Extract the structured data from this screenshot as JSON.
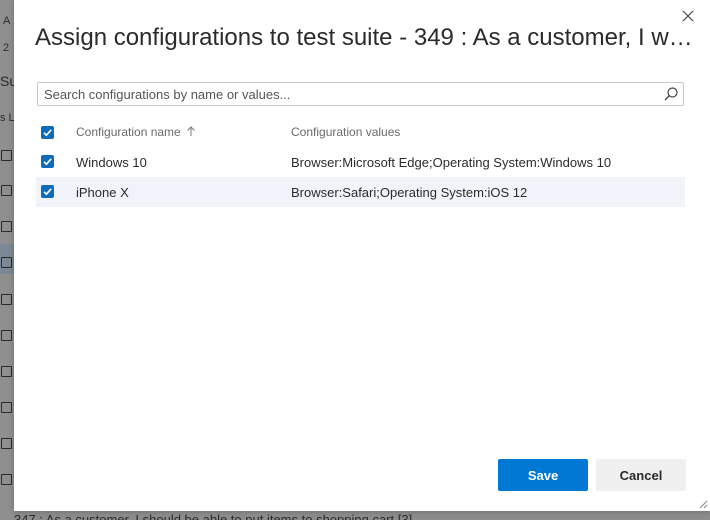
{
  "background": {
    "strip_fragments": [
      "A",
      "2",
      "Su",
      "s L"
    ],
    "bottom_text": "347 : As a customer, I should be able to put items to shopping cart [3]"
  },
  "dialog": {
    "title": "Assign configurations to test suite - 349 : As a customer, I wo...",
    "search": {
      "placeholder": "Search configurations by name or values...",
      "value": ""
    },
    "columns": {
      "name": "Configuration name",
      "values": "Configuration values"
    },
    "rows": [
      {
        "name": "Windows 10",
        "values": "Browser:Microsoft Edge;Operating System:Windows 10",
        "checked": true
      },
      {
        "name": "iPhone X",
        "values": "Browser:Safari;Operating System:iOS 12",
        "checked": true
      }
    ],
    "buttons": {
      "save": "Save",
      "cancel": "Cancel"
    }
  },
  "colors": {
    "primary": "#0078d4",
    "checkbox": "#0f6cbd",
    "selected_row": "#f0f4fa"
  }
}
